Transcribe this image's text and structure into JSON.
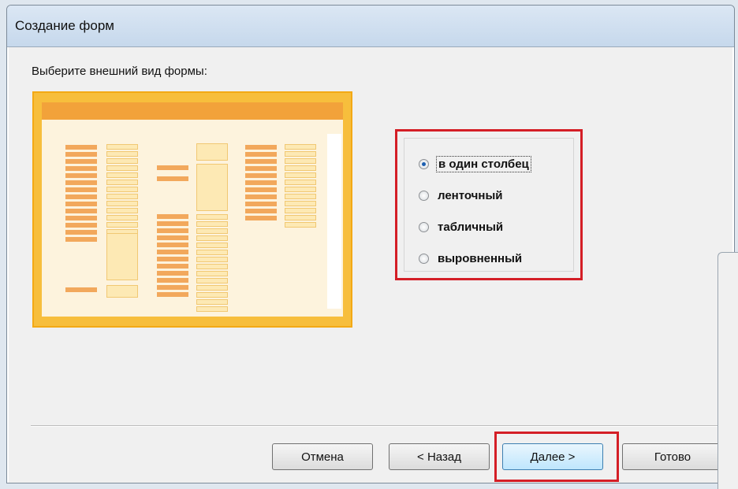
{
  "window": {
    "title": "Создание форм"
  },
  "prompt": "Выберите внешний вид формы:",
  "layout_options": [
    {
      "label": "в один столбец",
      "selected": true
    },
    {
      "label": "ленточный",
      "selected": false
    },
    {
      "label": "табличный",
      "selected": false
    },
    {
      "label": "выровненный",
      "selected": false
    }
  ],
  "buttons": {
    "cancel": "Отмена",
    "back": "< Назад",
    "next": "Далее >",
    "finish": "Готово"
  },
  "colors": {
    "highlight": "#d41e26",
    "preview_frame": "#f7be3c",
    "preview_label": "#f2a85c",
    "preview_field": "#fde9b4"
  }
}
